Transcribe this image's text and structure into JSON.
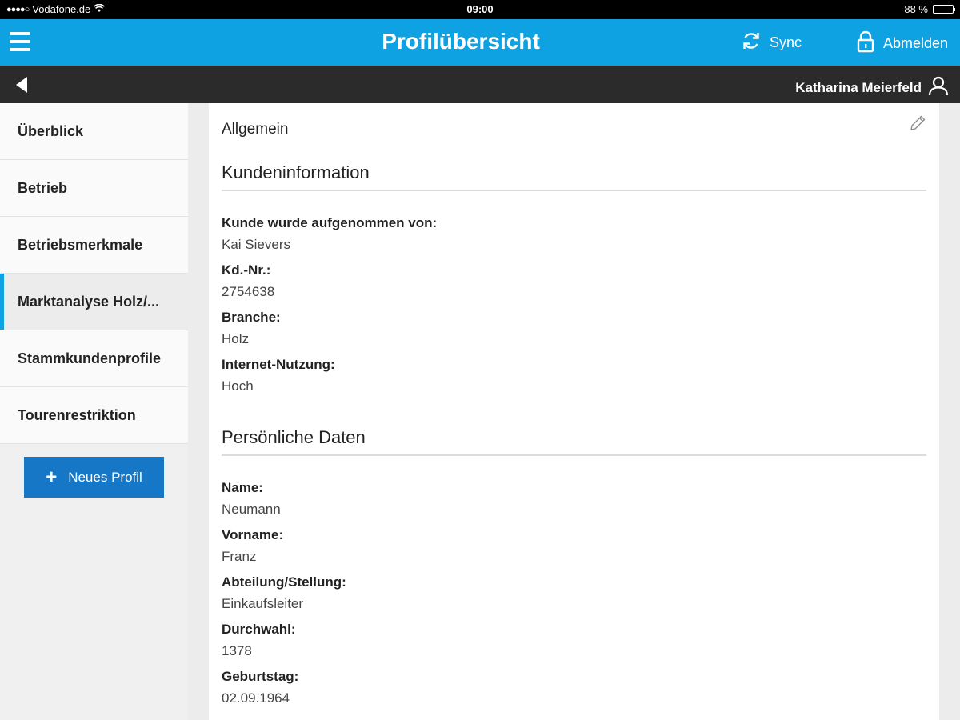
{
  "status": {
    "carrier": "Vodafone.de",
    "time": "09:00",
    "battery": "88 %",
    "battery_level": 0.88
  },
  "header": {
    "title": "Profilübersicht",
    "sync_label": "Sync",
    "logout_label": "Abmelden"
  },
  "subheader": {
    "user_name": "Katharina Meierfeld"
  },
  "sidebar": {
    "items": [
      {
        "label": "Überblick"
      },
      {
        "label": "Betrieb"
      },
      {
        "label": "Betriebsmerkmale"
      },
      {
        "label": "Marktanalyse Holz/..."
      },
      {
        "label": "Stammkundenprofile"
      },
      {
        "label": "Tourenrestriktion"
      }
    ],
    "active_index": 3,
    "new_button_label": "Neues Profil"
  },
  "main": {
    "section_general": "Allgemein",
    "kundeninfo": {
      "title": "Kundeninformation",
      "fields": [
        {
          "label": "Kunde wurde aufgenommen von:",
          "value": "Kai Sievers"
        },
        {
          "label": "Kd.-Nr.:",
          "value": "2754638"
        },
        {
          "label": "Branche:",
          "value": "Holz"
        },
        {
          "label": "Internet-Nutzung:",
          "value": "Hoch"
        }
      ]
    },
    "personal": {
      "title": "Persönliche Daten",
      "fields": [
        {
          "label": "Name:",
          "value": "Neumann"
        },
        {
          "label": "Vorname:",
          "value": "Franz"
        },
        {
          "label": "Abteilung/Stellung:",
          "value": "Einkaufsleiter"
        },
        {
          "label": "Durchwahl:",
          "value": "1378"
        },
        {
          "label": "Geburtstag:",
          "value": "02.09.1964"
        }
      ]
    }
  },
  "colors": {
    "brand_blue": "#0ea2e3",
    "button_blue": "#1677c7",
    "dark_bar": "#2b2b2b"
  }
}
